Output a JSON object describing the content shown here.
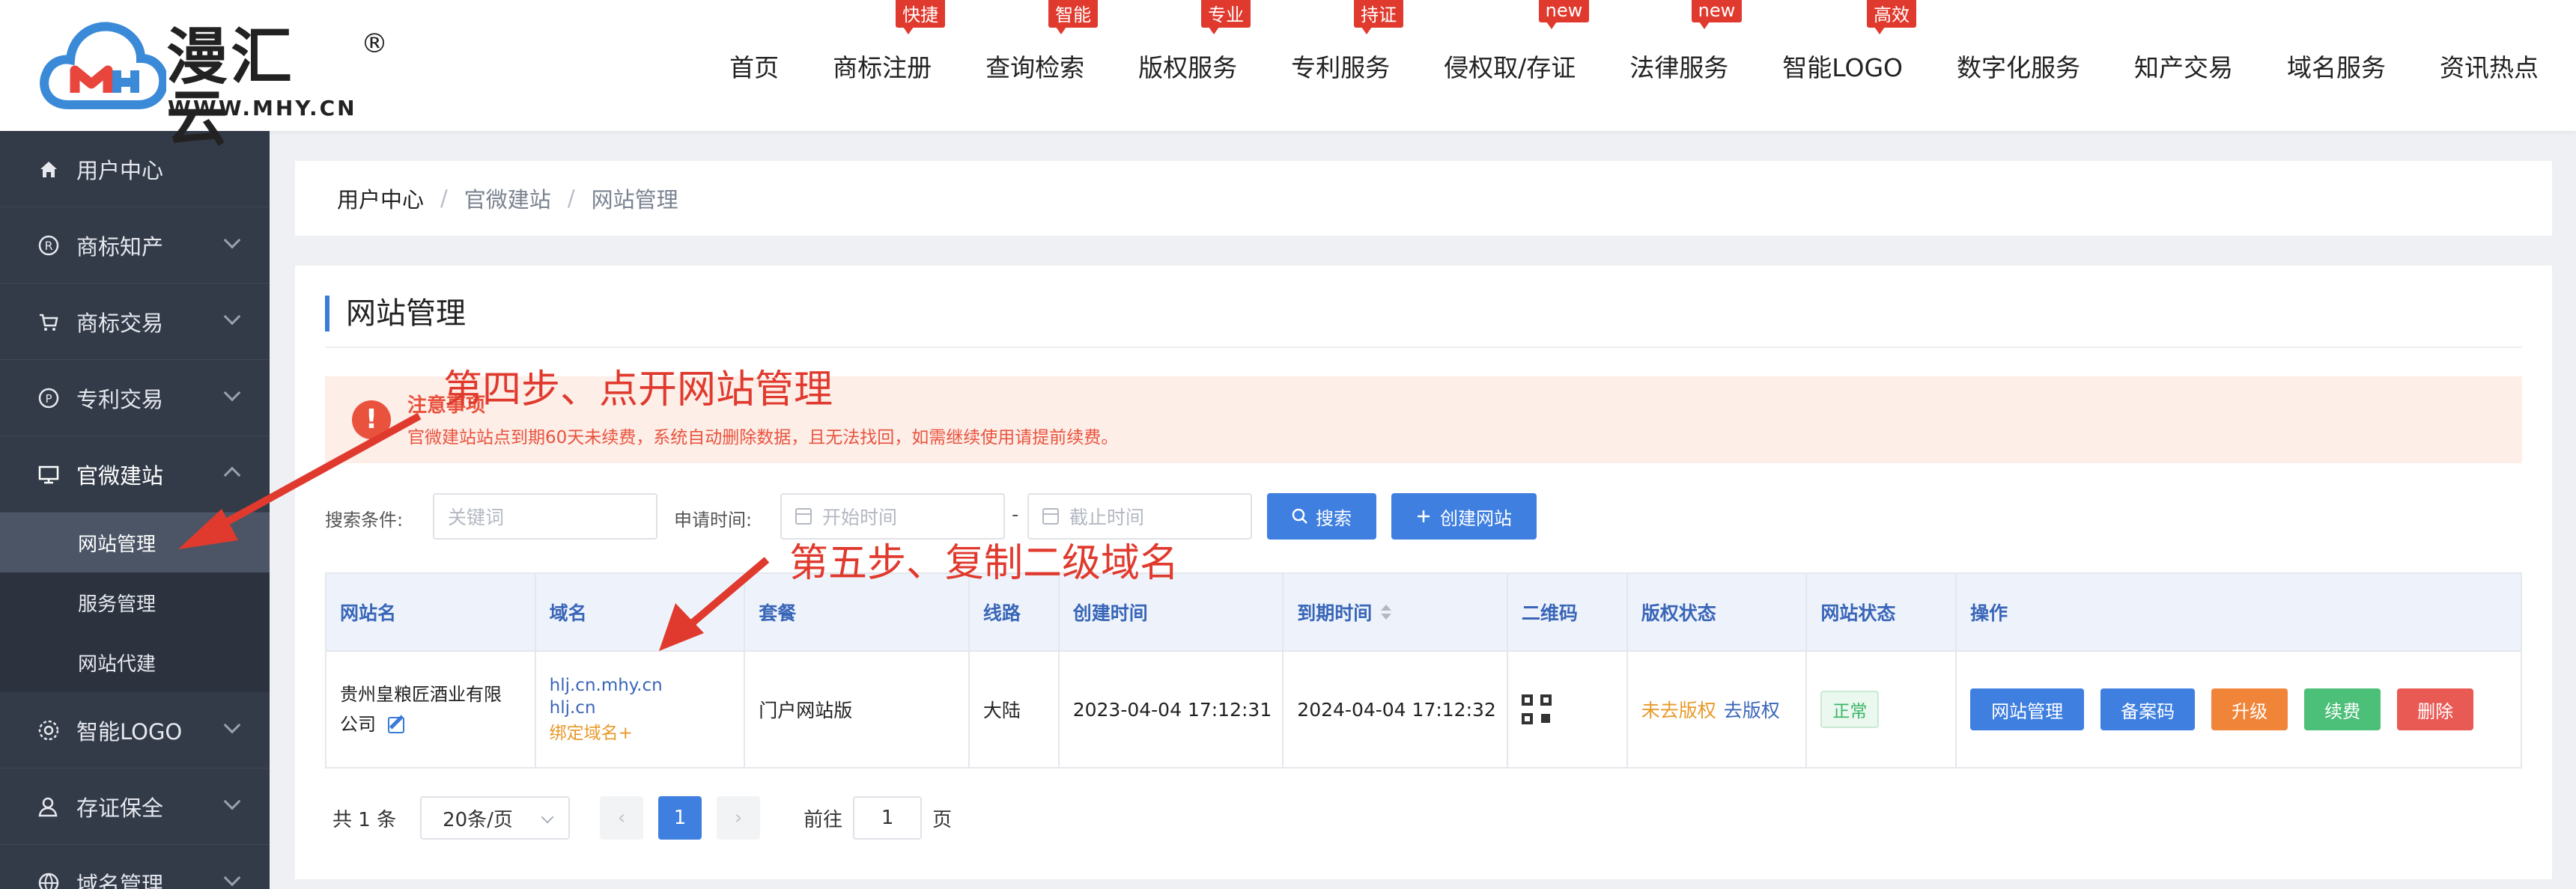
{
  "header": {
    "logo_text": "漫汇云",
    "logo_reg": "®",
    "logo_url": "WWW.MHY.CN",
    "nav": [
      {
        "label": "首页",
        "badge": ""
      },
      {
        "label": "商标注册",
        "badge": "快捷"
      },
      {
        "label": "查询检索",
        "badge": "智能"
      },
      {
        "label": "版权服务",
        "badge": "专业"
      },
      {
        "label": "专利服务",
        "badge": "持证"
      },
      {
        "label": "侵权取/存证",
        "badge": "new"
      },
      {
        "label": "法律服务",
        "badge": "new"
      },
      {
        "label": "智能LOGO",
        "badge": "高效"
      },
      {
        "label": "数字化服务",
        "badge": ""
      },
      {
        "label": "知产交易",
        "badge": ""
      },
      {
        "label": "域名服务",
        "badge": ""
      },
      {
        "label": "资讯热点",
        "badge": ""
      }
    ]
  },
  "sidebar": {
    "items": [
      {
        "label": "用户中心",
        "icon": "home-icon"
      },
      {
        "label": "商标知产",
        "icon": "registered-icon"
      },
      {
        "label": "商标交易",
        "icon": "cart-icon"
      },
      {
        "label": "专利交易",
        "icon": "patent-icon"
      },
      {
        "label": "官微建站",
        "icon": "monitor-icon"
      },
      {
        "label": "智能LOGO",
        "icon": "logo-icon"
      },
      {
        "label": "存证保全",
        "icon": "user-shield-icon"
      },
      {
        "label": "域名管理",
        "icon": "globe-icon"
      }
    ],
    "sub_items": [
      "网站管理",
      "服务管理",
      "网站代建"
    ]
  },
  "breadcrumb": {
    "current": "用户中心",
    "sep": "/",
    "items": [
      "官微建站",
      "网站管理"
    ]
  },
  "page": {
    "title": "网站管理"
  },
  "notice": {
    "title": "注意事项",
    "text": "官微建站站点到期60天未续费，系统自动删除数据，且无法找回，如需继续使用请提前续费。",
    "icon": "alert-icon"
  },
  "search": {
    "condition_label": "搜索条件:",
    "keyword_placeholder": "关键词",
    "time_label": "申请时间:",
    "start_placeholder": "开始时间",
    "end_placeholder": "截止时间",
    "dash": "-",
    "search_btn": "搜索",
    "create_btn": "创建网站"
  },
  "table": {
    "headers": [
      "网站名",
      "域名",
      "套餐",
      "线路",
      "创建时间",
      "到期时间",
      "二维码",
      "版权状态",
      "网站状态",
      "操作"
    ],
    "row": {
      "site_name": "贵州皇粮匠酒业有限公司",
      "domain_1": "hlj.cn.mhy.cn",
      "domain_2": "hlj.cn",
      "bind_domain": "绑定域名+",
      "package": "门户网站版",
      "line": "大陆",
      "created": "2023-04-04 17:12:31",
      "expires": "2024-04-04 17:12:32",
      "copyright_status": "未去版权",
      "copyright_action": "去版权",
      "site_status": "正常",
      "ops": [
        {
          "label": "网站管理",
          "color": "#3f7fe0"
        },
        {
          "label": "备案码",
          "color": "#3f7fe0"
        },
        {
          "label": "升级",
          "color": "#f0853a"
        },
        {
          "label": "续费",
          "color": "#4cbf78"
        },
        {
          "label": "删除",
          "color": "#ea5a55"
        }
      ]
    }
  },
  "pager": {
    "total": "共 1 条",
    "page_size": "20条/页",
    "current_page": "1",
    "goto_label": "前往",
    "goto_value": "1",
    "page_unit": "页"
  },
  "annotations": {
    "step4": "第四步、点开网站管理",
    "step5": "第五步、复制二级域名"
  }
}
